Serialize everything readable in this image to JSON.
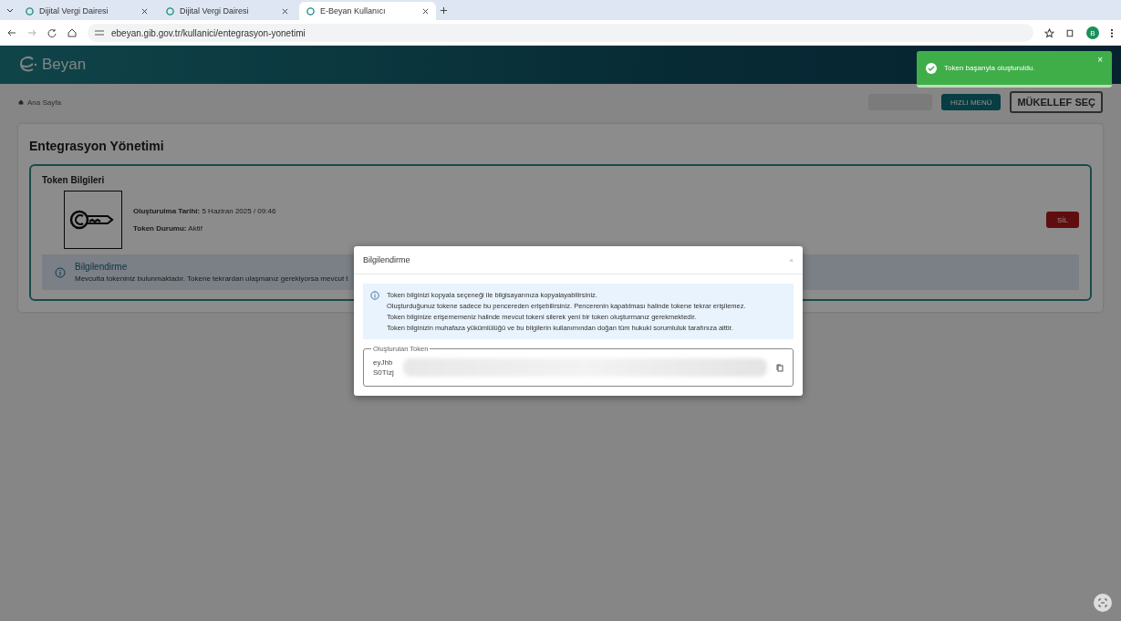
{
  "browser": {
    "tabs": [
      {
        "title": "Dijital Vergi Dairesi",
        "selected": false
      },
      {
        "title": "Dijital Vergi Dairesi",
        "selected": false
      },
      {
        "title": "E-Beyan Kullanıcı",
        "selected": true
      }
    ],
    "url": "ebeyan.gib.gov.tr/kullanici/entegrasyon-yonetimi",
    "profile_initial": "B"
  },
  "header": {
    "logo_text": "Beyan"
  },
  "toast": {
    "message": "Token başarıyla oluşturuldu.",
    "close": "×"
  },
  "breadcrumb": "Ana Sayfa",
  "toolbar": {
    "quick_menu": "HIZLI MENÜ",
    "taxpayer_select": "MÜKELLEF SEÇ"
  },
  "page": {
    "title": "Entegrasyon Yönetimi",
    "token_card": {
      "title": "Token Bilgileri",
      "fields": [
        {
          "label": "Oluşturulma Tarihi:",
          "value": "5 Haziran 2025 / 09:46"
        },
        {
          "label": "Token Durumu:",
          "value": "Aktif"
        }
      ],
      "delete_button": "SİL",
      "info": {
        "title": "Bilgilendirme",
        "text": "Mevcutta tokeniniz bulunmaktadır. Tokene tekrardan ulaşmanız gerekiyorsa mevcut t"
      }
    }
  },
  "modal": {
    "title": "Bilgilendirme",
    "close": "×",
    "info_lines": [
      "Token bilginizi kopyala seçeneği ile bilgisayarınıza kopyalayabilirsiniz.",
      "Oluşturduğunuz tokene sadece bu pencereden erişebilirsiniz. Pencerenin kapatılması halinde tokene tekrar erişilemez.",
      "Token bilginize erişememeniz halinde mevcut tokeni silerek yeni bir token oluşturmanız gerekmektedir.",
      "Token bilginizin muhafaza yükümlülüğü ve bu bilgilerin kullanımından doğan tüm hukuki sorumluluk tarafınıza aittir."
    ],
    "token_field": {
      "label": "Oluşturulan Token",
      "lines": [
        "eyJhb",
        "S0TIzj"
      ]
    }
  }
}
